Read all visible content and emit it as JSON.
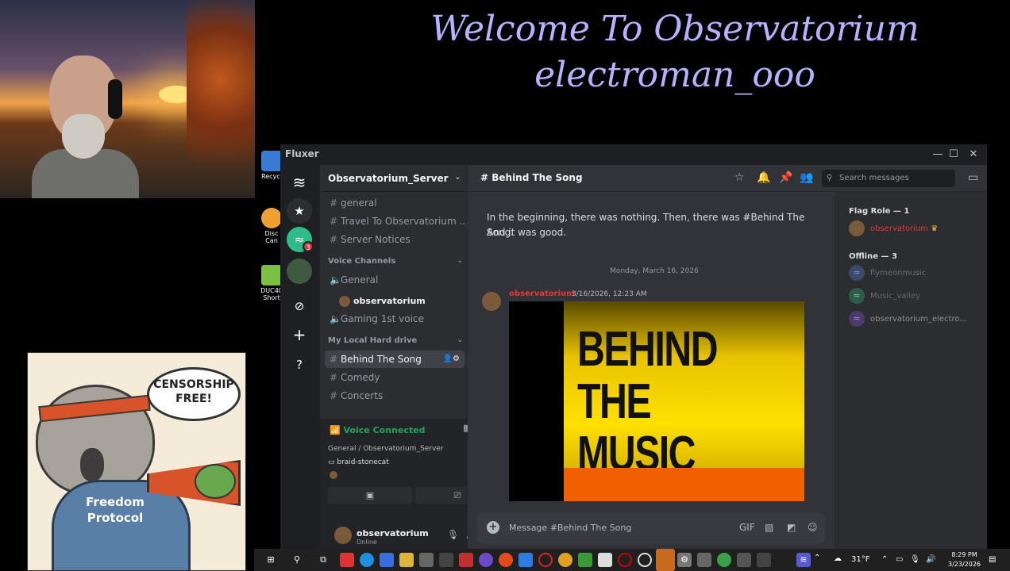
{
  "overlay": {
    "line1": "Welcome To Observatorium",
    "line2": "electroman_ooo"
  },
  "poster": {
    "bubble": "CENSORSHIP FREE!",
    "shirt": "Freedom Protocol"
  },
  "desktop": {
    "icons": [
      "Recycl",
      "Disc Can",
      "DUC40 Short"
    ]
  },
  "window": {
    "app_name": "Fluxer"
  },
  "server": {
    "name": "Observatorium_Server",
    "rail_badge": "3"
  },
  "channels": {
    "text_top": [
      "general",
      "Travel To Observatorium ...",
      "Server Notices"
    ],
    "voice_category": "Voice Channels",
    "voice": [
      "General",
      "Gaming 1st voice"
    ],
    "voice_user": "observatorium",
    "local_category": "My Local Hard drive",
    "local": [
      "Behind The Song",
      "Comedy",
      "Concerts"
    ]
  },
  "voice_panel": {
    "status": "Voice Connected",
    "location": "General / Observatorium_Server",
    "device": "braid-stonecat"
  },
  "user_bar": {
    "name": "observatorium",
    "status": "Online"
  },
  "chat": {
    "channel": "Behind The Song",
    "search_placeholder": "Search messages",
    "intro_line1": "In the beginning, there was nothing. Then, there was #Behind The Song.",
    "intro_line2": "And it was good.",
    "date_divider": "Monday, March 16, 2026",
    "message": {
      "author": "observatorium",
      "timestamp": "3/16/2026, 12:23 AM"
    },
    "embed_lines": [
      "BEHIND",
      "THE",
      "MUSIC"
    ],
    "input_placeholder": "Message #Behind The Song"
  },
  "members": {
    "flag_role": "Flag Role — 1",
    "online_member": "observatorium",
    "offline_role": "Offline — 3",
    "offline_members": [
      "flymeonmusic",
      "Music_valley",
      "observatorium_electro..."
    ]
  },
  "taskbar": {
    "weather": "31°F",
    "time": "8:29 PM",
    "date": "3/23/2026"
  },
  "colors": {
    "accent_green": "#23a55a",
    "owner_red": "#e03b3b",
    "overlay_text": "#b9b1ff"
  }
}
